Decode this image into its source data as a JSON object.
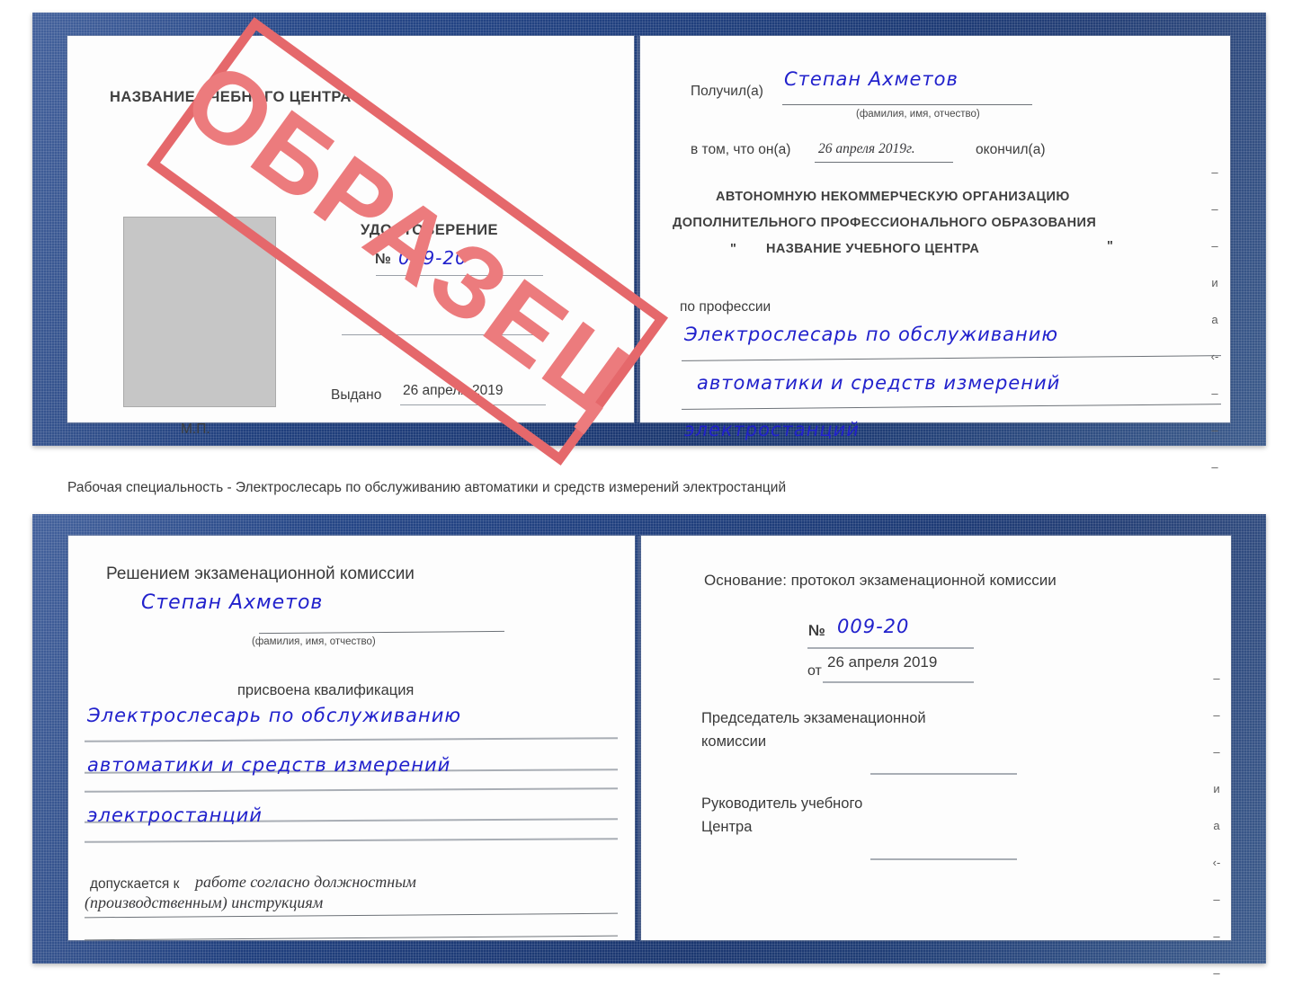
{
  "document": {
    "type": "Удостоверение",
    "caption": "Рабочая специальность - Электрослесарь по обслуживанию автоматики и средств измерений электростанций",
    "ink_color": "#2121cc",
    "cover_color": "#23447f",
    "stamp_color": "#e5686b",
    "photo_placeholder_color": "#c6c6c6"
  },
  "stamp": {
    "text": "ОБРАЗЕЦ"
  },
  "certificate_front": {
    "left_page": {
      "org_title": "НАЗВАНИЕ УЧЕБНОГО ЦЕНТРА",
      "doc_title": "УДОСТОВЕРЕНИЕ",
      "number_label": "№",
      "number_value": "009-20",
      "issued_label": "Выдано",
      "issued_value": "26 апреля 2019",
      "seal_label": "М.П."
    },
    "right_page": {
      "received_label": "Получил(а)",
      "received_value": "Степан Ахметов",
      "name_hint": "(фамилия, имя, отчество)",
      "in_that_label": "в том, что он(а)",
      "in_that_value": "26 апреля 2019г.",
      "finished_label": "окончил(а)",
      "org_line1": "АВТОНОМНУЮ НЕКОММЕРЧЕСКУЮ ОРГАНИЗАЦИЮ",
      "org_line2": "ДОПОЛНИТЕЛЬНОГО ПРОФЕССИОНАЛЬНОГО ОБРАЗОВАНИЯ",
      "org_quote_open": "\"",
      "org_line3": "НАЗВАНИЕ УЧЕБНОГО ЦЕНТРА",
      "org_quote_close": "\"",
      "profession_label": "по профессии",
      "profession_line1": "Электрослесарь по обслуживанию",
      "profession_line2": "автоматики и средств измерений",
      "profession_line3": "электростанций"
    },
    "edge_marks": [
      "–",
      "–",
      "–",
      "и",
      "а",
      "‹-",
      "–",
      "–",
      "–",
      "–"
    ]
  },
  "certificate_back": {
    "left_page": {
      "decision_title": "Решением экзаменационной комиссии",
      "name_value": "Степан Ахметов",
      "name_hint": "(фамилия, имя, отчество)",
      "qualification_label": "присвоена квалификация",
      "qualification_line1": "Электрослесарь по обслуживанию",
      "qualification_line2": "автоматики и средств измерений",
      "qualification_line3": "электростанций",
      "admitted_label": "допускается к",
      "admitted_line1": "работе согласно должностным",
      "admitted_line2": "(производственным) инструкциям"
    },
    "right_page": {
      "basis_label": "Основание: протокол экзаменационной комиссии",
      "number_label": "№",
      "number_value": "009-20",
      "date_label": "от",
      "date_value": "26 апреля 2019",
      "chairman_line1": "Председатель экзаменационной",
      "chairman_line2": "комиссии",
      "head_line1": "Руководитель учебного",
      "head_line2": "Центра"
    },
    "edge_marks": [
      "–",
      "–",
      "–",
      "и",
      "а",
      "‹-",
      "–",
      "–",
      "–",
      "–"
    ]
  }
}
